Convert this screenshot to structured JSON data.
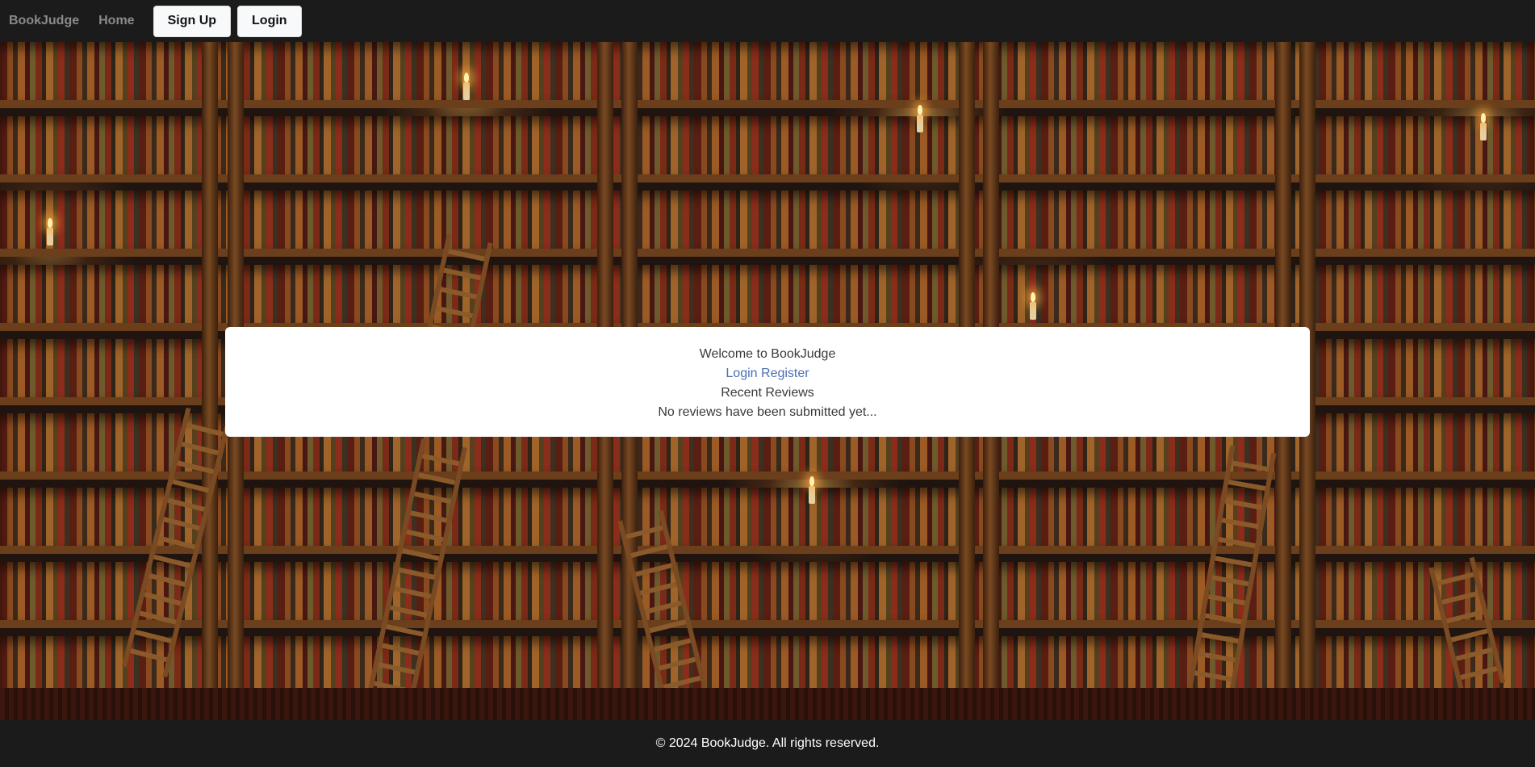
{
  "navbar": {
    "brand": "BookJudge",
    "home_label": "Home",
    "signup_label": "Sign Up",
    "login_label": "Login"
  },
  "welcome": {
    "title": "Welcome to BookJudge",
    "login_link": "Login",
    "register_link": "Register",
    "recent_heading": "Recent Reviews",
    "empty_message": "No reviews have been submitted yet..."
  },
  "footer": {
    "text": "© 2024 BookJudge. All rights reserved."
  },
  "colors": {
    "navbar_bg": "#1b1b1b",
    "nav_text": "#8a8a8a",
    "link": "#4a6fb5",
    "card_bg": "#ffffff"
  }
}
